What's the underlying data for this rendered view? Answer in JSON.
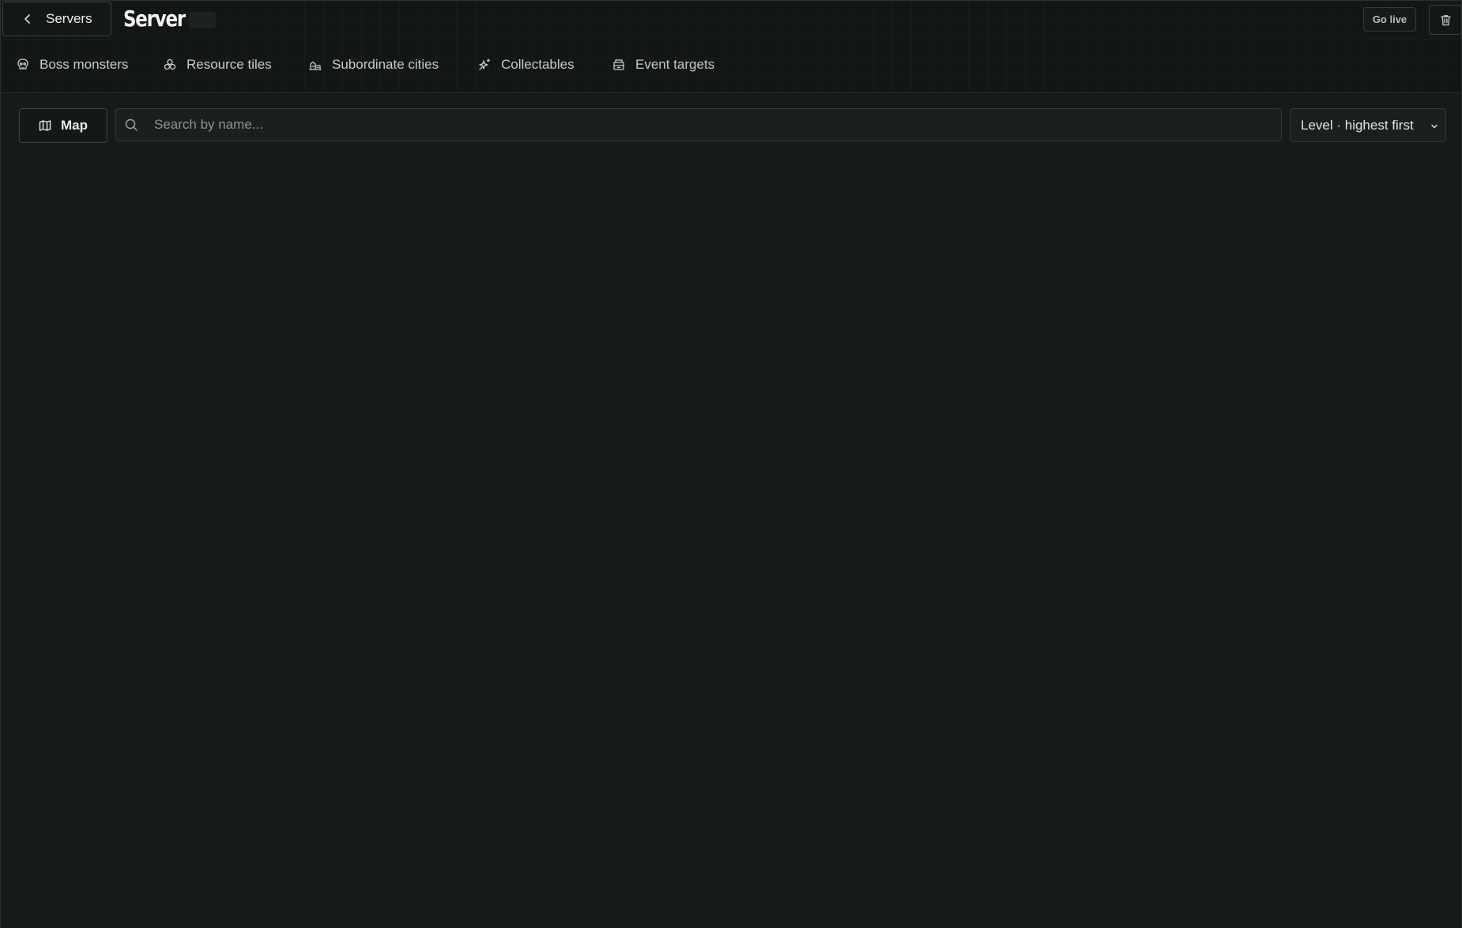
{
  "header": {
    "back_label": "Servers",
    "title": "Server",
    "golive_label": "Go live"
  },
  "tabs": [
    {
      "label": "Boss monsters",
      "icon": "skull-icon"
    },
    {
      "label": "Resource tiles",
      "icon": "resources-icon"
    },
    {
      "label": "Subordinate cities",
      "icon": "city-icon"
    },
    {
      "label": "Collectables",
      "icon": "sparkle-icon"
    },
    {
      "label": "Event targets",
      "icon": "target-building-icon"
    }
  ],
  "toolbar": {
    "map_label": "Map",
    "search_placeholder": "Search by name...",
    "search_value": "",
    "sort_value": "Level · highest first"
  },
  "colors": {
    "background": "#121614",
    "panel": "#161a18",
    "border": "#3a423d",
    "text": "#d9dcd8"
  }
}
